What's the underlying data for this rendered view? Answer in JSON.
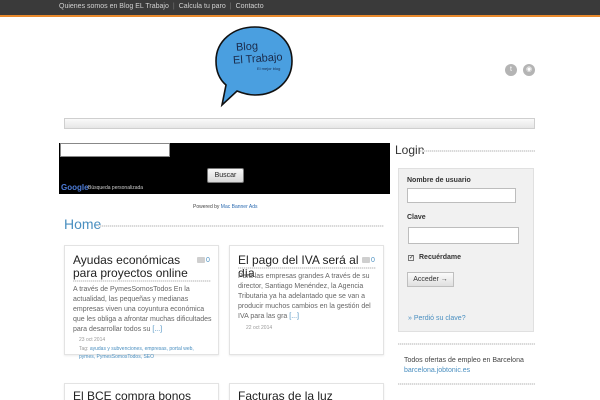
{
  "topnav": {
    "items": [
      "Quienes somos en Blog EL Trabajo",
      "Calcula tu paro",
      "Contacto"
    ]
  },
  "logo": {
    "line1": "Blog",
    "line2": "El Trabajo",
    "sub": "El mejor blog"
  },
  "social": {
    "twitter": "twitter-icon",
    "rss": "rss-icon"
  },
  "search": {
    "button": "Buscar",
    "google": "Google",
    "label": "Búsqueda personalizada",
    "powered_prefix": "Powered by",
    "powered_link": "Mac Banner Ads"
  },
  "home_title": "Home",
  "posts": [
    {
      "title": "Ayudas económicas para proyectos online",
      "comments": "0",
      "excerpt": "A través de PymesSomosTodos En la actualidad, las pequeñas y medianas empresas viven una coyuntura económica que les obliga a afrontar muchas dificultades para desarrollar todos su",
      "more": "[...]",
      "date": "23 oct 2014",
      "tags_label": "Tag:",
      "tags": "ayudas y subvenciones, empresas, portal web, pymes, PymesSomosTodos, SEO"
    },
    {
      "title": "El pago del IVA será al día",
      "comments": "0",
      "excerpt": "Para las empresas grandes A través de su director, Santiago Menéndez, la Agencia Tributaria ya ha adelantado que se van a producir muchos cambios en la gestión del IVA para las gra",
      "more": "[...]",
      "date": "22 oct 2014"
    },
    {
      "title": "El BCE compra bonos"
    },
    {
      "title": "Facturas de la luz"
    }
  ],
  "login": {
    "title": "Login",
    "username_label": "Nombre de usuario",
    "password_label": "Clave",
    "remember": "Recuérdame",
    "button": "Acceder →",
    "lost": "Perdió su clave?"
  },
  "jobs": {
    "text": "Todos ofertas de empleo en Barcelona",
    "link": "barcelona.jobtonic.es"
  },
  "colors": {
    "accent": "#4a8fc0",
    "topbar": "#3a3a3a",
    "topbar_border": "#e8892c"
  }
}
